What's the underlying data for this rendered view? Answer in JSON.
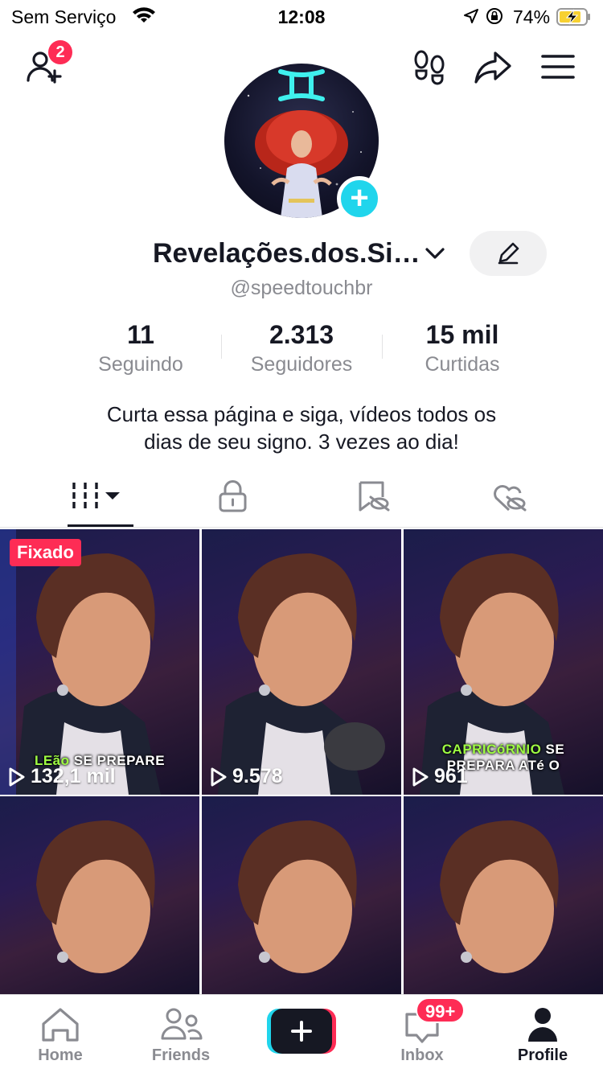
{
  "status_bar": {
    "carrier": "Sem Serviço",
    "time": "12:08",
    "battery_percent": "74%"
  },
  "header": {
    "add_friend_badge": "2"
  },
  "profile": {
    "display_name": "Revelações.dos.Si…",
    "username": "@speedtouchbr",
    "stats": [
      {
        "value": "11",
        "label": "Seguindo"
      },
      {
        "value": "2.313",
        "label": "Seguidores"
      },
      {
        "value": "15 mil",
        "label": "Curtidas"
      }
    ],
    "bio_line1": "Curta essa página e siga, vídeos todos os",
    "bio_line2": "dias de seu signo. 3 vezes ao dia!"
  },
  "tabs": [
    {
      "icon": "grid-icon"
    },
    {
      "icon": "lock-icon"
    },
    {
      "icon": "bookmark-hidden-icon"
    },
    {
      "icon": "heart-hidden-icon"
    }
  ],
  "videos": [
    {
      "views": "132,1 mil",
      "pinned_label": "Fixado",
      "caption_a": "LEão",
      "caption_b": " SE PREPARE"
    },
    {
      "views": "9.578"
    },
    {
      "views": "961",
      "caption_a": "CAPRICóRNIO",
      "caption_b": " SE",
      "caption_line2": "PREPARA ATé O"
    },
    {
      "views": ""
    },
    {
      "views": ""
    },
    {
      "views": ""
    }
  ],
  "bottom_nav": {
    "home": "Home",
    "friends": "Friends",
    "inbox": "Inbox",
    "inbox_badge": "99+",
    "profile": "Profile"
  },
  "colors": {
    "accent_red": "#fe2c55",
    "accent_cyan": "#20d5ec",
    "text_primary": "#161823",
    "text_secondary": "#8a8b91"
  }
}
